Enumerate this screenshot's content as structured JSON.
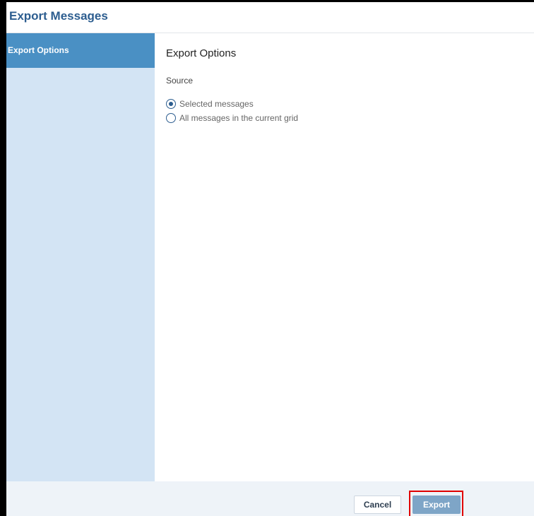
{
  "window": {
    "title": "Export Messages"
  },
  "sidebar": {
    "items": [
      {
        "label": "Export Options",
        "active": true
      }
    ]
  },
  "main": {
    "section_title": "Export Options",
    "source": {
      "label": "Source",
      "options": [
        {
          "label": "Selected messages",
          "checked": true
        },
        {
          "label": "All messages in the current grid",
          "checked": false
        }
      ]
    }
  },
  "footer": {
    "cancel_label": "Cancel",
    "export_label": "Export"
  },
  "colors": {
    "title": "#2c5d8f",
    "sidebar_bg": "#d3e4f4",
    "sidebar_active": "#4a90c4",
    "export_button": "#7ea5c7",
    "highlight": "#e00000"
  }
}
